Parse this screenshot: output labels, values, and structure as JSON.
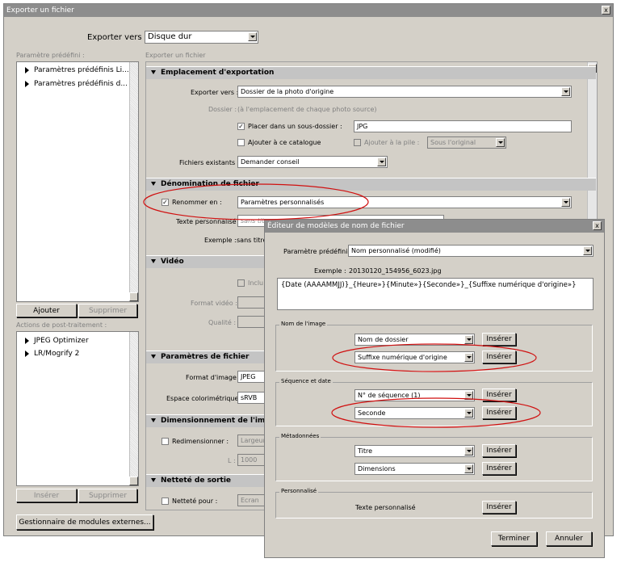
{
  "main": {
    "title": "Exporter un fichier",
    "close": "x",
    "export_to_label": "Exporter vers :",
    "export_to_value": "Disque dur",
    "presets_label": "Paramètre prédéfini :",
    "export_file_label": "Exporter un fichier",
    "presets": [
      "Paramètres prédéfinis Li...",
      "Paramètres prédéfinis d..."
    ],
    "add_btn": "Ajouter",
    "delete_btn": "Supprimer",
    "post_label": "Actions de post-traitement :",
    "post_items": [
      "JPEG Optimizer",
      "LR/Mogrify 2"
    ],
    "insert_btn": "Insérer",
    "delete_btn2": "Supprimer",
    "plugin_btn": "Gestionnaire de modules externes..."
  },
  "location": {
    "header": "Emplacement d'exportation",
    "export_to_label": "Exporter vers :",
    "export_to_value": "Dossier de la photo d'origine",
    "folder_label": "Dossier :",
    "folder_value": "(à l'emplacement de chaque photo source)",
    "subfolder_label": "Placer dans un sous-dossier :",
    "subfolder_value": "JPG",
    "catalog_label": "Ajouter à ce catalogue",
    "stack_label": "Ajouter à la pile :",
    "stack_value": "Sous l'original",
    "existing_label": "Fichiers existants :",
    "existing_value": "Demander conseil"
  },
  "naming": {
    "header": "Dénomination de fichier",
    "rename_label": "Renommer en :",
    "rename_value": "Paramètres personnalisés",
    "custom_label": "Texte personnalisé :",
    "custom_value": "sans tit",
    "example_label": "Exemple :",
    "example_value": "sans titre"
  },
  "video": {
    "header": "Vidéo",
    "include_label": "Inclu",
    "format_label": "Format vidéo :",
    "quality_label": "Qualité :"
  },
  "fileset": {
    "header": "Paramètres de fichier",
    "format_label": "Format d'image :",
    "format_value": "JPEG",
    "space_label": "Espace colorimétrique :",
    "space_value": "sRVB"
  },
  "sizing": {
    "header": "Dimensionnement de l'image",
    "resize_label": "Redimensionner :",
    "resize_value": "Largeur",
    "l_label": "L :",
    "l_value": "1000"
  },
  "sharpen": {
    "header": "Netteté de sortie",
    "label": "Netteté pour :",
    "value": "Ecran"
  },
  "editor": {
    "title": "Éditeur de modèles de nom de fichier",
    "close": "x",
    "preset_label": "Paramètre prédéfini :",
    "preset_value": "Nom personnalisé (modifié)",
    "example_label": "Exemple :",
    "example_value": "20130120_154956_6023.jpg",
    "template": "{Date (AAAAMMJJ)}_{Heure»}{Minute»}{Seconde»}_{Suffixe numérique d'origine»}",
    "group_image": "Nom de l'image",
    "img_sel1": "Nom de dossier",
    "img_sel2": "Suffixe numérique d'origine",
    "group_seq": "Séquence et date",
    "seq_sel1": "N° de séquence (1)",
    "seq_sel2": "Seconde",
    "group_meta": "Métadonnées",
    "meta_sel1": "Titre",
    "meta_sel2": "Dimensions",
    "group_custom": "Personnalisé",
    "custom_text": "Texte personnalisé",
    "insert": "Insérer",
    "finish": "Terminer",
    "cancel": "Annuler"
  },
  "colors": {
    "annotation": "#d01010",
    "title_bar": "#8d8d8d",
    "dialog": "#d4d0c8"
  }
}
